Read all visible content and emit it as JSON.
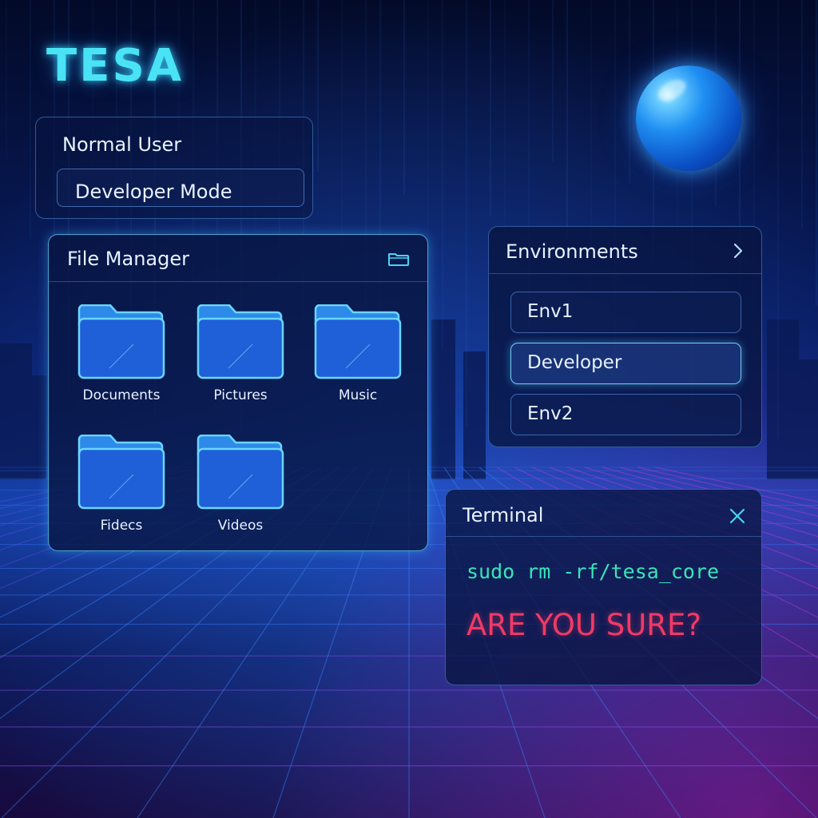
{
  "app": {
    "logo": "TESA"
  },
  "user": {
    "name": "Normal User",
    "mode_label": "Developer Mode"
  },
  "file_manager": {
    "title": "File Manager",
    "icon": "folder-outline-icon",
    "folders": [
      {
        "label": "Documents",
        "icon": "folder-icon"
      },
      {
        "label": "Pictures",
        "icon": "folder-icon"
      },
      {
        "label": "Music",
        "icon": "folder-icon"
      },
      {
        "label": "Fidecs",
        "icon": "folder-icon"
      },
      {
        "label": "Videos",
        "icon": "folder-icon"
      }
    ]
  },
  "environments": {
    "title": "Environments",
    "icon": "chevron-right-icon",
    "items": [
      {
        "label": "Env1",
        "selected": false
      },
      {
        "label": "Developer",
        "selected": true
      },
      {
        "label": "Env2",
        "selected": false
      }
    ]
  },
  "terminal": {
    "title": "Terminal",
    "close_icon": "close-icon",
    "command": "sudo rm -rf/tesa_core",
    "warning": "ARE YOU SURE?"
  },
  "colors": {
    "background": "#040c2e",
    "accent_cyan": "#49e3f5",
    "command_green": "#39e4b8",
    "warning_red": "#f03a66",
    "grid_magenta": "#d03ad8"
  }
}
